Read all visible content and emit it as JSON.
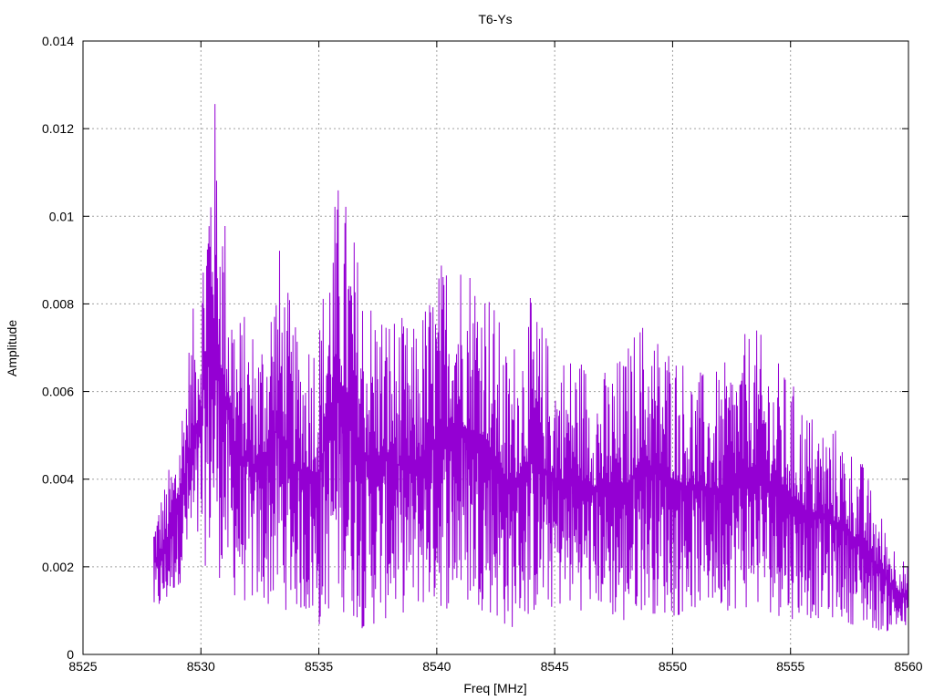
{
  "chart_data": {
    "type": "line",
    "title": "T6-Ys",
    "xlabel": "Freq [MHz]",
    "ylabel": "Amplitude",
    "xlim": [
      8525,
      8560
    ],
    "ylim": [
      0,
      0.014
    ],
    "xticks": [
      8525,
      8530,
      8535,
      8540,
      8545,
      8550,
      8555,
      8560
    ],
    "xtick_labels": [
      "8525",
      "8530",
      "8535",
      "8540",
      "8545",
      "8550",
      "8555",
      "8560"
    ],
    "yticks": [
      0,
      0.002,
      0.004,
      0.006,
      0.008,
      0.01,
      0.012,
      0.014
    ],
    "ytick_labels": [
      "0",
      "0.002",
      "0.004",
      "0.006",
      "0.008",
      "0.01",
      "0.012",
      "0.014"
    ],
    "grid": true,
    "series_color": "#9400d3",
    "series": [
      {
        "x_start": 8528.0,
        "x_end": 8560.0,
        "envelope": [
          {
            "x": 8528.0,
            "low": 0.0008,
            "high": 0.0033
          },
          {
            "x": 8528.5,
            "low": 0.001,
            "high": 0.004
          },
          {
            "x": 8529.0,
            "low": 0.0015,
            "high": 0.005
          },
          {
            "x": 8529.5,
            "low": 0.002,
            "high": 0.0073
          },
          {
            "x": 8530.0,
            "low": 0.002,
            "high": 0.0091
          },
          {
            "x": 8530.5,
            "low": 0.002,
            "high": 0.0134
          },
          {
            "x": 8531.0,
            "low": 0.0015,
            "high": 0.0104
          },
          {
            "x": 8531.5,
            "low": 0.0012,
            "high": 0.008
          },
          {
            "x": 8532.5,
            "low": 0.001,
            "high": 0.0075
          },
          {
            "x": 8533.3,
            "low": 0.001,
            "high": 0.0095
          },
          {
            "x": 8534.0,
            "low": 0.001,
            "high": 0.0075
          },
          {
            "x": 8535.0,
            "low": 0.0005,
            "high": 0.0078
          },
          {
            "x": 8535.5,
            "low": 0.001,
            "high": 0.01
          },
          {
            "x": 8535.9,
            "low": 0.001,
            "high": 0.0111
          },
          {
            "x": 8537.0,
            "low": 0.0005,
            "high": 0.0085
          },
          {
            "x": 8538.0,
            "low": 0.0008,
            "high": 0.008
          },
          {
            "x": 8539.0,
            "low": 0.001,
            "high": 0.0075
          },
          {
            "x": 8540.6,
            "low": 0.001,
            "high": 0.0096
          },
          {
            "x": 8542.0,
            "low": 0.001,
            "high": 0.009
          },
          {
            "x": 8543.0,
            "low": 0.0005,
            "high": 0.007
          },
          {
            "x": 8544.0,
            "low": 0.0008,
            "high": 0.0082
          },
          {
            "x": 8545.0,
            "low": 0.001,
            "high": 0.007
          },
          {
            "x": 8546.0,
            "low": 0.001,
            "high": 0.007
          },
          {
            "x": 8547.0,
            "low": 0.001,
            "high": 0.0065
          },
          {
            "x": 8548.0,
            "low": 0.0005,
            "high": 0.007
          },
          {
            "x": 8548.6,
            "low": 0.001,
            "high": 0.0078
          },
          {
            "x": 8550.0,
            "low": 0.0008,
            "high": 0.0072
          },
          {
            "x": 8551.0,
            "low": 0.001,
            "high": 0.0065
          },
          {
            "x": 8552.0,
            "low": 0.001,
            "high": 0.0065
          },
          {
            "x": 8553.4,
            "low": 0.001,
            "high": 0.0076
          },
          {
            "x": 8555.0,
            "low": 0.0008,
            "high": 0.0063
          },
          {
            "x": 8556.0,
            "low": 0.0008,
            "high": 0.0055
          },
          {
            "x": 8557.0,
            "low": 0.0008,
            "high": 0.0052
          },
          {
            "x": 8558.0,
            "low": 0.0006,
            "high": 0.0045
          },
          {
            "x": 8559.0,
            "low": 0.0005,
            "high": 0.003
          },
          {
            "x": 8560.0,
            "low": 0.0005,
            "high": 0.002
          }
        ]
      }
    ]
  }
}
